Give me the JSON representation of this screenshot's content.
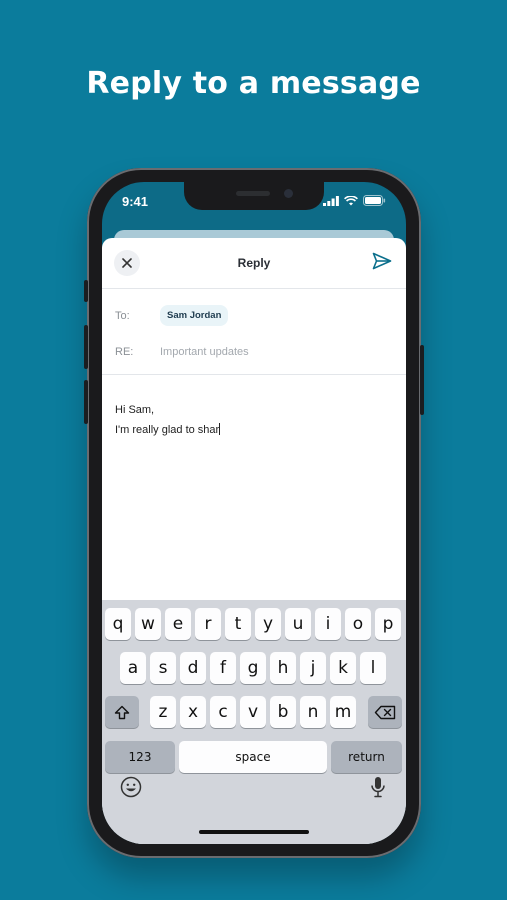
{
  "headline": "Reply to a message",
  "status_bar": {
    "time": "9:41"
  },
  "compose": {
    "title": "Reply",
    "to_label": "To:",
    "recipient": "Sam Jordan",
    "re_label": "RE:",
    "re_value": "Important updates",
    "body_line1": "Hi Sam,",
    "body_line2": "I'm really glad to shar"
  },
  "keyboard": {
    "row1": [
      "q",
      "w",
      "e",
      "r",
      "t",
      "y",
      "u",
      "i",
      "o",
      "p"
    ],
    "row2": [
      "a",
      "s",
      "d",
      "f",
      "g",
      "h",
      "j",
      "k",
      "l"
    ],
    "row3": [
      "z",
      "x",
      "c",
      "v",
      "b",
      "n",
      "m"
    ],
    "numbers_label": "123",
    "space_label": "space",
    "return_label": "return"
  },
  "icons": {
    "close": "close-icon",
    "send": "send-icon",
    "shift": "shift-icon",
    "delete": "backspace-icon",
    "emoji": "emoji-icon",
    "mic": "microphone-icon",
    "signal": "signal-icon",
    "wifi": "wifi-icon",
    "battery": "battery-icon"
  },
  "colors": {
    "background": "#0b7c9c",
    "accent": "#0b6f8c",
    "chip": "#e9f4f8"
  }
}
